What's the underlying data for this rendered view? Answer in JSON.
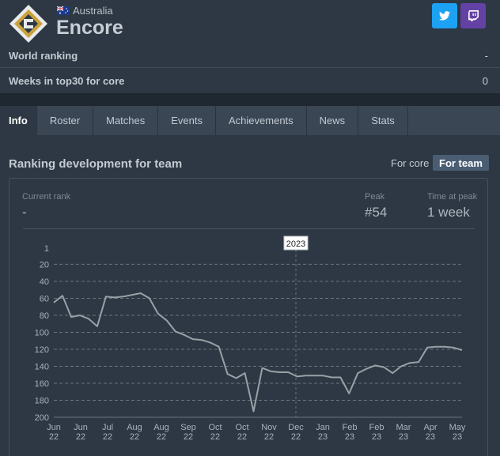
{
  "team": {
    "country": "Australia",
    "name": "Encore"
  },
  "social": {
    "twitter_icon": "twitter-icon",
    "twitch_icon": "twitch-icon"
  },
  "stats": {
    "world_ranking_label": "World ranking",
    "world_ranking_value": "-",
    "weeks_label": "Weeks in top30 for core",
    "weeks_value": "0"
  },
  "tabs": [
    {
      "label": "Info",
      "active": true
    },
    {
      "label": "Roster"
    },
    {
      "label": "Matches"
    },
    {
      "label": "Events"
    },
    {
      "label": "Achievements"
    },
    {
      "label": "News"
    },
    {
      "label": "Stats"
    }
  ],
  "ranking": {
    "title": "Ranking development for team",
    "toggle_core": "For core",
    "toggle_team": "For team",
    "current_rank_label": "Current rank",
    "current_rank_value": "-",
    "peak_label": "Peak",
    "peak_value": "#54",
    "time_at_peak_label": "Time at peak",
    "time_at_peak_value": "1 week"
  },
  "colors": {
    "accent": "#4a5d73",
    "twitter": "#1da1f2",
    "twitch": "#6441a5",
    "line": "#9aa0a6"
  },
  "chart_data": {
    "type": "line",
    "title": "",
    "xlabel": "",
    "ylabel": "",
    "y_inverted": true,
    "ylim": [
      1,
      200
    ],
    "y_ticks": [
      1,
      20,
      40,
      60,
      80,
      100,
      120,
      140,
      160,
      180,
      200
    ],
    "x_ticks": [
      {
        "month": "Jun",
        "year": "22"
      },
      {
        "month": "Jun",
        "year": "22"
      },
      {
        "month": "Jul",
        "year": "22"
      },
      {
        "month": "Aug",
        "year": "22"
      },
      {
        "month": "Aug",
        "year": "22"
      },
      {
        "month": "Sep",
        "year": "22"
      },
      {
        "month": "Oct",
        "year": "22"
      },
      {
        "month": "Oct",
        "year": "22"
      },
      {
        "month": "Nov",
        "year": "22"
      },
      {
        "month": "Dec",
        "year": "22"
      },
      {
        "month": "Jan",
        "year": "23"
      },
      {
        "month": "Feb",
        "year": "23"
      },
      {
        "month": "Feb",
        "year": "23"
      },
      {
        "month": "Mar",
        "year": "23"
      },
      {
        "month": "Apr",
        "year": "23"
      },
      {
        "month": "May",
        "year": "23"
      }
    ],
    "marker_label": "2023",
    "marker_index": 9,
    "grid": true,
    "series": [
      {
        "values": [
          65,
          57,
          82,
          80,
          84,
          93,
          58,
          59,
          58,
          56,
          54,
          60,
          78,
          86,
          99,
          103,
          108,
          109,
          112,
          117,
          149,
          154,
          148,
          193,
          142,
          146,
          147,
          147,
          152,
          151,
          151,
          151,
          153,
          153,
          172,
          148,
          143,
          139,
          141,
          148,
          140,
          136,
          135,
          118,
          117,
          117,
          118,
          121
        ]
      }
    ]
  }
}
